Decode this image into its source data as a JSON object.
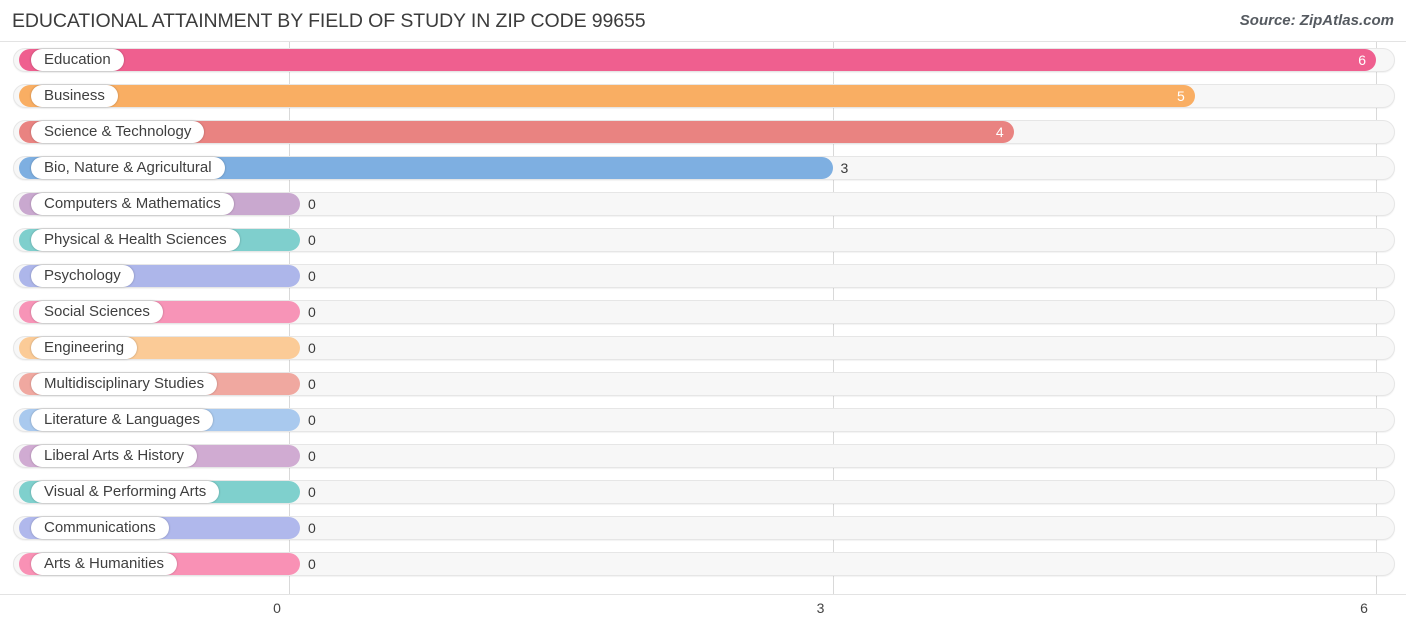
{
  "header": {
    "title": "EDUCATIONAL ATTAINMENT BY FIELD OF STUDY IN ZIP CODE 99655",
    "source": "Source: ZipAtlas.com"
  },
  "chart_data": {
    "type": "bar",
    "orientation": "horizontal",
    "title": "EDUCATIONAL ATTAINMENT BY FIELD OF STUDY IN ZIP CODE 99655",
    "xlabel": "",
    "ylabel": "",
    "xlim": [
      0,
      6
    ],
    "xticks": [
      "0",
      "3",
      "6"
    ],
    "xtick_values": [
      0,
      3,
      6
    ],
    "grid": true,
    "legend": false,
    "categories": [
      "Education",
      "Business",
      "Science & Technology",
      "Bio, Nature & Agricultural",
      "Computers & Mathematics",
      "Physical & Health Sciences",
      "Psychology",
      "Social Sciences",
      "Engineering",
      "Multidisciplinary Studies",
      "Literature & Languages",
      "Liberal Arts & History",
      "Visual & Performing Arts",
      "Communications",
      "Arts & Humanities"
    ],
    "values": [
      6,
      5,
      4,
      3,
      0,
      0,
      0,
      0,
      0,
      0,
      0,
      0,
      0,
      0,
      0
    ],
    "value_labels": [
      "6",
      "5",
      "4",
      "3",
      "0",
      "0",
      "0",
      "0",
      "0",
      "0",
      "0",
      "0",
      "0",
      "0",
      "0"
    ],
    "colors": [
      "#ef5f8f",
      "#f9ae63",
      "#e98381",
      "#7eafe1",
      "#c9a8cf",
      "#7fcfcd",
      "#adb6ea",
      "#f794b7",
      "#fbcb97",
      "#f0a8a0",
      "#a9c9ee",
      "#d0abd2",
      "#7fd0cd",
      "#b0b8ec",
      "#f991b5"
    ]
  },
  "rows": [
    {
      "label": "Education",
      "value": 6,
      "value_label": "6",
      "color": "#ef5f8f",
      "label_inside": true
    },
    {
      "label": "Business",
      "value": 5,
      "value_label": "5",
      "color": "#f9ae63",
      "label_inside": true
    },
    {
      "label": "Science & Technology",
      "value": 4,
      "value_label": "4",
      "color": "#e98381",
      "label_inside": true
    },
    {
      "label": "Bio, Nature & Agricultural",
      "value": 3,
      "value_label": "3",
      "color": "#7eafe1",
      "label_inside": false
    },
    {
      "label": "Computers & Mathematics",
      "value": 0,
      "value_label": "0",
      "color": "#c9a8cf",
      "label_inside": false
    },
    {
      "label": "Physical & Health Sciences",
      "value": 0,
      "value_label": "0",
      "color": "#7fcfcd",
      "label_inside": false
    },
    {
      "label": "Psychology",
      "value": 0,
      "value_label": "0",
      "color": "#adb6ea",
      "label_inside": false
    },
    {
      "label": "Social Sciences",
      "value": 0,
      "value_label": "0",
      "color": "#f794b7",
      "label_inside": false
    },
    {
      "label": "Engineering",
      "value": 0,
      "value_label": "0",
      "color": "#fbcb97",
      "label_inside": false
    },
    {
      "label": "Multidisciplinary Studies",
      "value": 0,
      "value_label": "0",
      "color": "#f0a8a0",
      "label_inside": false
    },
    {
      "label": "Literature & Languages",
      "value": 0,
      "value_label": "0",
      "color": "#a9c9ee",
      "label_inside": false
    },
    {
      "label": "Liberal Arts & History",
      "value": 0,
      "value_label": "0",
      "color": "#d0abd2",
      "label_inside": false
    },
    {
      "label": "Visual & Performing Arts",
      "value": 0,
      "value_label": "0",
      "color": "#7fd0cd",
      "label_inside": false
    },
    {
      "label": "Communications",
      "value": 0,
      "value_label": "0",
      "color": "#b0b8ec",
      "label_inside": false
    },
    {
      "label": "Arts & Humanities",
      "value": 0,
      "value_label": "0",
      "color": "#f991b5",
      "label_inside": false
    }
  ],
  "axis": {
    "ticks": [
      "0",
      "3",
      "6"
    ]
  }
}
